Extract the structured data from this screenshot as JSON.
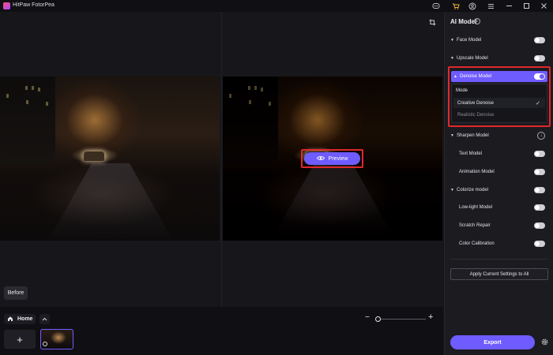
{
  "app": {
    "title": "HitPaw FotorPea",
    "title_icons": [
      "discord-icon",
      "cart-icon",
      "account-icon",
      "menu-icon",
      "minimize-icon",
      "maximize-icon",
      "close-icon"
    ]
  },
  "canvas": {
    "preview_label": "Preview",
    "before_label": "Before"
  },
  "bottom": {
    "home_label": "Home",
    "add_label": "+",
    "zoom_minus": "−",
    "zoom_plus": "+",
    "zoom_level": 0.0
  },
  "panel": {
    "title": "AI Model",
    "models": [
      {
        "label": "Face Model",
        "caret": true,
        "toggle": false
      },
      {
        "label": "Upscale Model",
        "caret": true,
        "toggle": false
      },
      {
        "label": "Denoise Model",
        "caret": true,
        "toggle": true,
        "expanded": true
      },
      {
        "label": "Sharpen Model",
        "caret": true,
        "download": true
      },
      {
        "label": "Text Model",
        "toggle": false
      },
      {
        "label": "Animation Model",
        "toggle": false
      },
      {
        "label": "Colorize model",
        "caret": true,
        "toggle": false
      },
      {
        "label": "Low-light Model",
        "toggle": false
      },
      {
        "label": "Scratch Repair",
        "toggle": false
      },
      {
        "label": "Color Calibration",
        "toggle": false
      }
    ],
    "denoise": {
      "mode_label": "Mode",
      "options": [
        {
          "label": "Creative Denoise",
          "selected": true
        },
        {
          "label": "Realistic Denoise",
          "selected": false
        }
      ]
    },
    "apply_label": "Apply Current Settings to All",
    "export_label": "Export"
  },
  "colors": {
    "accent": "#6f5cff",
    "highlight": "#e0282b",
    "background": "#141418"
  }
}
